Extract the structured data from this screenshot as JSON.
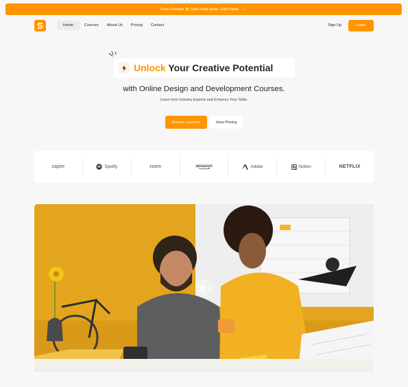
{
  "banner": {
    "text": "Free Courses 🌟 Sale Ends Soon, Get It Now",
    "arrow": "→"
  },
  "nav": {
    "links": [
      "Home",
      "Courses",
      "About Us",
      "Pricing",
      "Contact"
    ],
    "signup": "Sign Up",
    "login": "Login"
  },
  "hero": {
    "highlight": "Unlock",
    "title_rest": " Your Creative Potential",
    "subtitle": "with Online Design and Development Courses.",
    "description": "Learn from Industry Experts and Enhance Your Skills.",
    "explore_label": "Explore Courses",
    "pricing_label": "View Pricing"
  },
  "brands": [
    "zapier",
    "Spotify",
    "zoom",
    "amazon",
    "Adobe",
    "Notion",
    "NETFLIX"
  ],
  "colors": {
    "accent": "#ff9500",
    "background": "#f7f7f8"
  },
  "video": {
    "icon": "play-icon"
  }
}
